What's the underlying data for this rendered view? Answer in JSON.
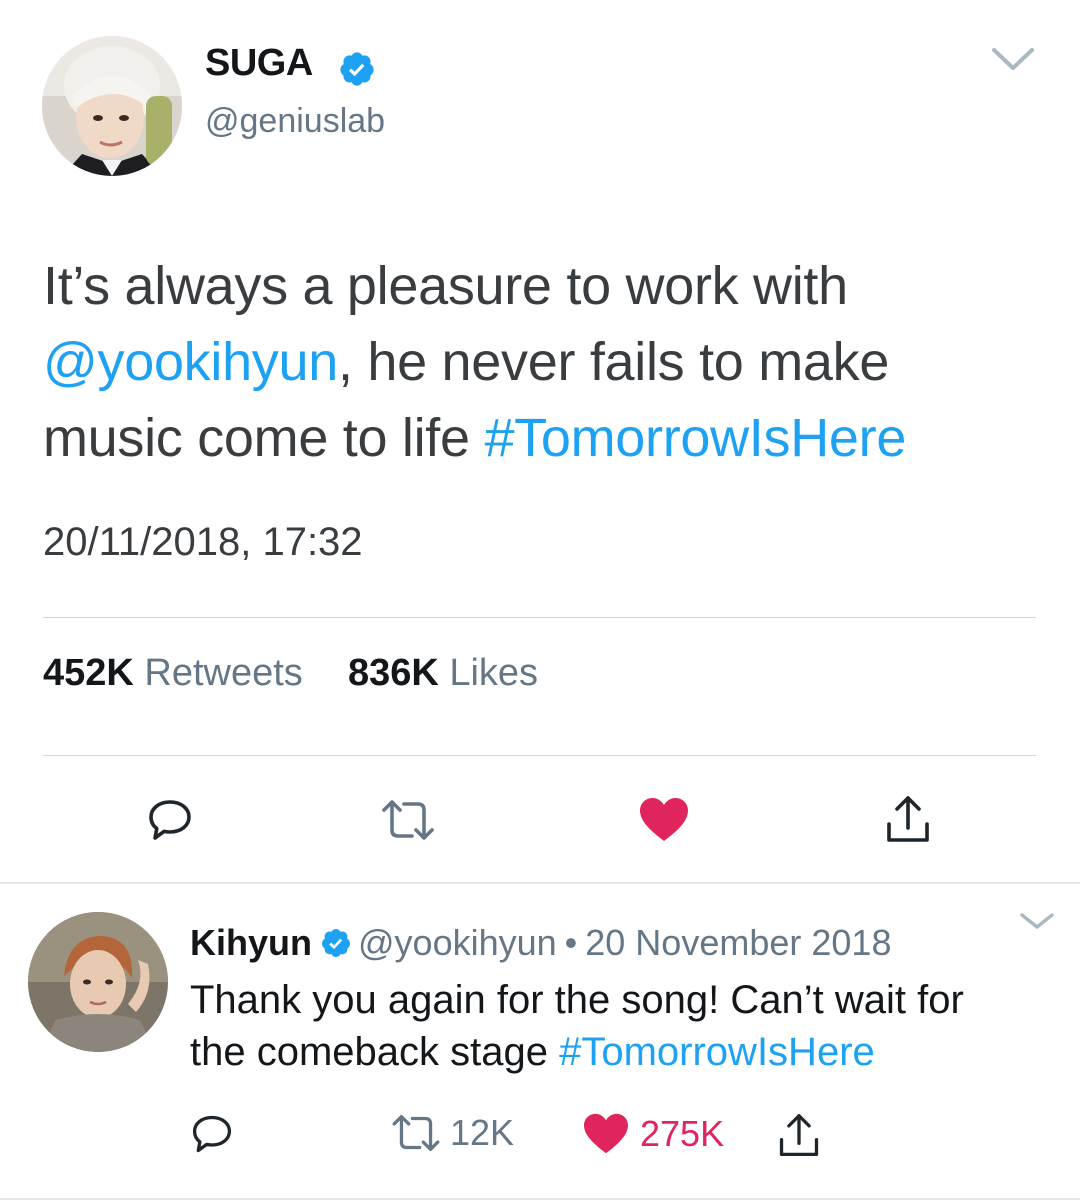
{
  "main_tweet": {
    "author": {
      "name": "SUGA",
      "handle": "@geniuslab",
      "verified": true,
      "avatar_icon": "profile-photo"
    },
    "text_lines": [
      [
        {
          "text": "It’s always a pleasure to work with",
          "type": "text"
        }
      ],
      [
        {
          "text": "@yookihyun",
          "type": "mention"
        },
        {
          "text": ", he never fails to make",
          "type": "text"
        }
      ],
      [
        {
          "text": "music come to life ",
          "type": "text"
        },
        {
          "text": "#TomorrowIsHere",
          "type": "hashtag"
        }
      ]
    ],
    "timestamp": "20/11/2018, 17:32",
    "stats": {
      "retweets_count": "452K",
      "retweets_label": "Retweets",
      "likes_count": "836K",
      "likes_label": "Likes"
    },
    "actions": [
      "reply-icon",
      "retweet-icon",
      "like-icon",
      "share-icon"
    ],
    "liked": true
  },
  "reply_tweet": {
    "author": {
      "name": "Kihyun",
      "handle": "@yookihyun",
      "verified": true,
      "avatar_icon": "profile-photo"
    },
    "separator": "•",
    "date": "20 November 2018",
    "text_lines": [
      [
        {
          "text": "Thank you again for the song! Can’t wait for",
          "type": "text"
        }
      ],
      [
        {
          "text": "the comeback stage ",
          "type": "text"
        },
        {
          "text": "#TomorrowIsHere",
          "type": "hashtag"
        }
      ]
    ],
    "retweet_count": "12K",
    "like_count": "275K",
    "liked": true,
    "actions": [
      "reply-icon",
      "retweet-icon",
      "like-icon",
      "share-icon"
    ]
  },
  "colors": {
    "link": "#1da1f2",
    "like": "#e0245e",
    "secondary_text": "#657786",
    "verified": "#1da1f2",
    "divider": "#ccd6dd"
  }
}
